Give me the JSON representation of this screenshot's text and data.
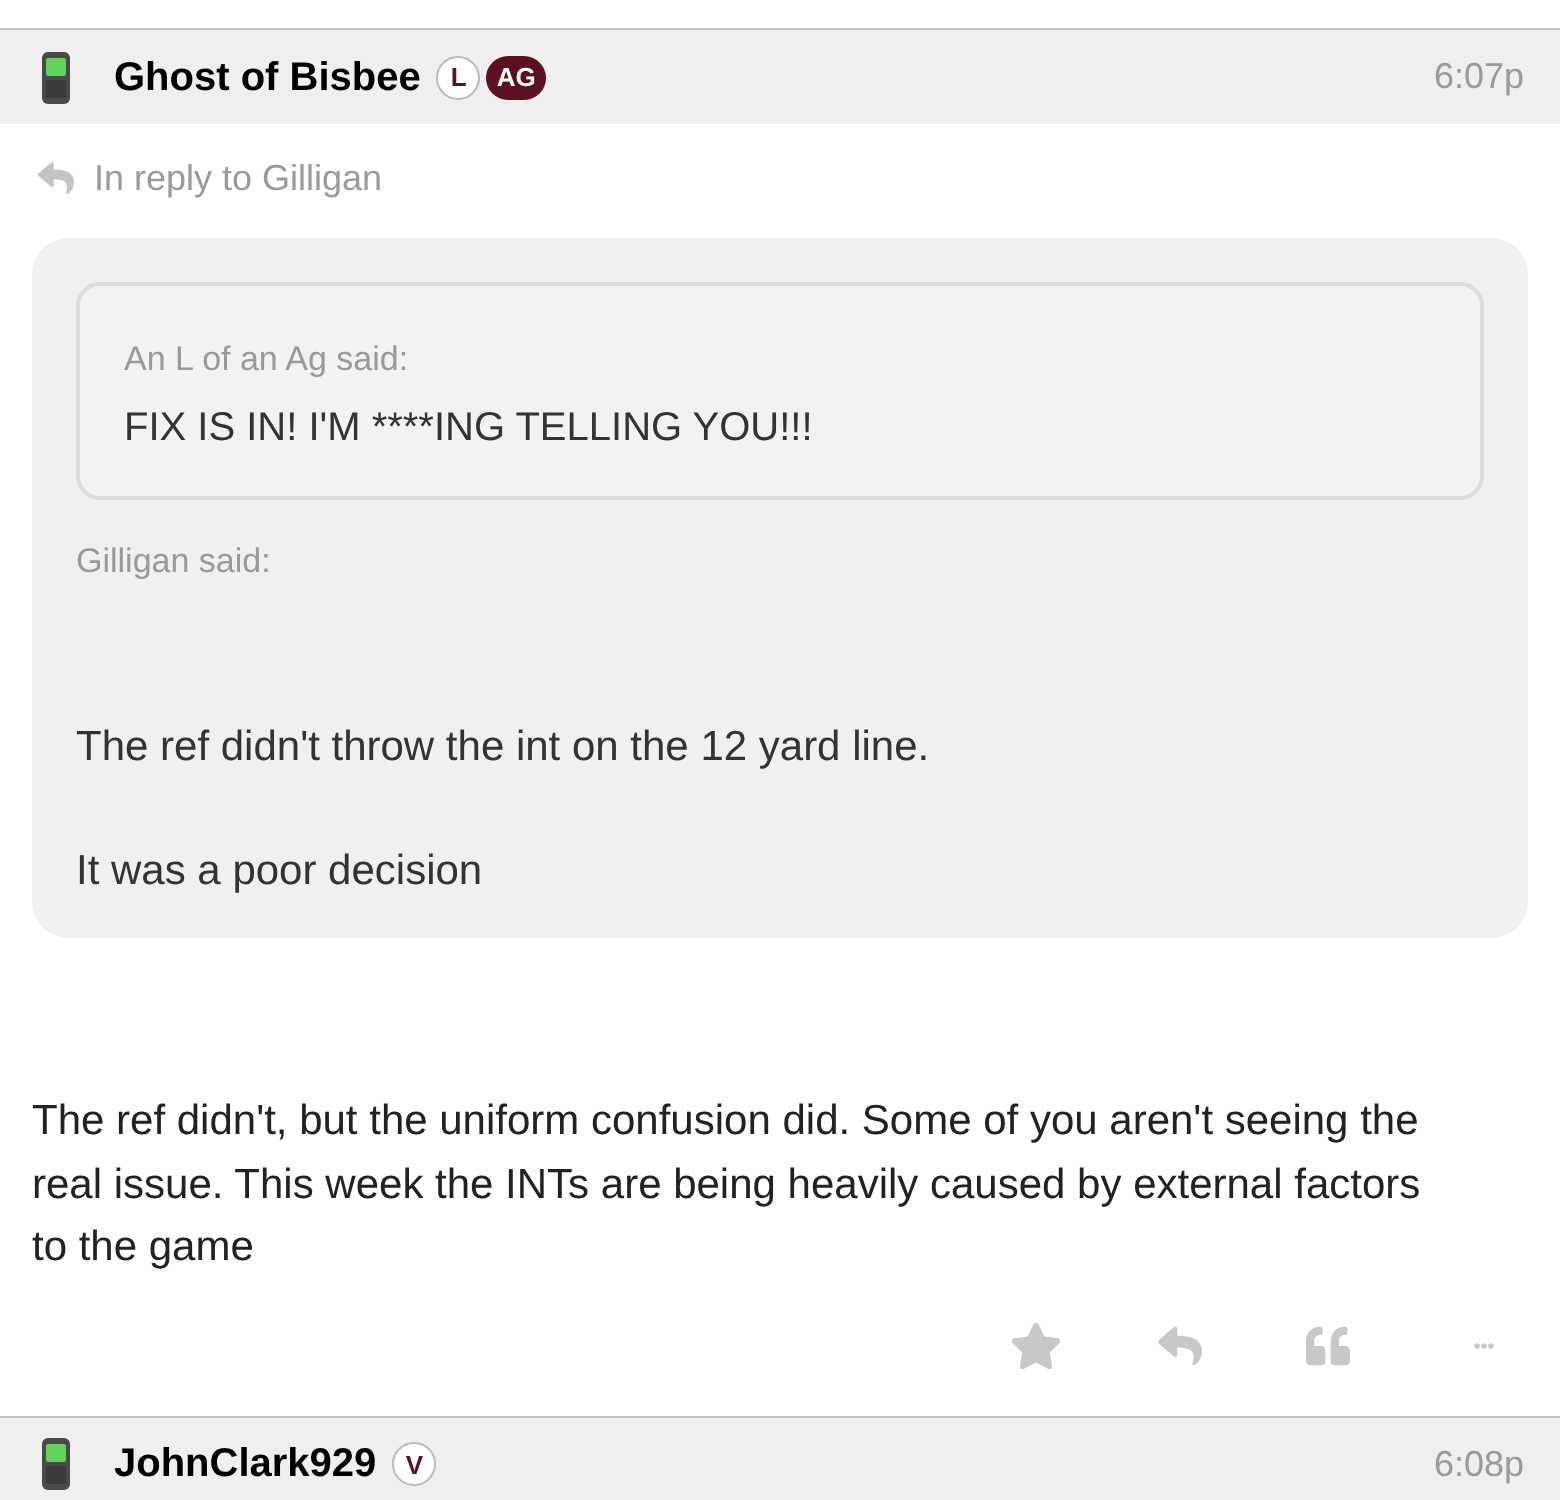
{
  "posts": [
    {
      "author": "Ghost of Bisbee",
      "badges": [
        {
          "kind": "outline",
          "text": "L"
        },
        {
          "kind": "filled",
          "text": "AG"
        }
      ],
      "time": "6:07p",
      "reply_to": "In reply to Gilligan",
      "quote": {
        "nested_quote": {
          "attribution": "An L of an Ag said:",
          "text": "FIX IS IN! I'M ****ING TELLING YOU!!!"
        },
        "attribution": "Gilligan said:",
        "paragraphs": [
          "The ref didn't throw the int on the 12 yard line.",
          "It was a poor decision"
        ]
      },
      "body": "The ref didn't, but the uniform confusion did. Some of you aren't seeing the real issue. This week the INTs are being heavily caused by external factors to the game"
    },
    {
      "author": "JohnClark929",
      "badges": [
        {
          "kind": "outline",
          "text": "V"
        }
      ],
      "time": "6:08p"
    }
  ]
}
